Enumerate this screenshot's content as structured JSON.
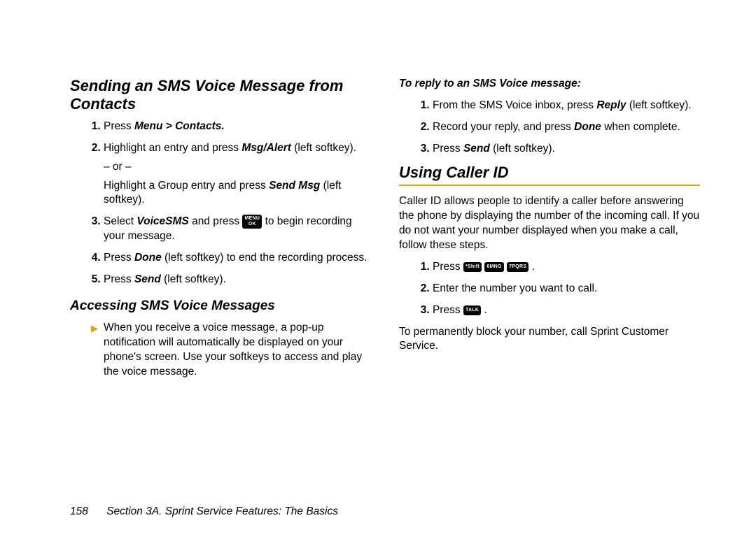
{
  "left": {
    "h1": "Sending an SMS Voice Message from Contacts",
    "steps": {
      "s1_a": "Press ",
      "s1_b": "Menu > Contacts.",
      "s2_a": "Highlight an entry and press ",
      "s2_b": "Msg/Alert",
      "s2_c": " (left softkey).",
      "s2_or": "– or –",
      "s2_d": "Highlight a Group entry and press ",
      "s2_e": "Send Msg",
      "s2_f": " (left softkey).",
      "s3_a": "Select ",
      "s3_b": "VoiceSMS",
      "s3_c": " and press ",
      "s3_key": "MENU\nOK",
      "s3_d": " to begin recording your message.",
      "s4_a": "Press ",
      "s4_b": "Done",
      "s4_c": " (left softkey) to end the recording process.",
      "s5_a": "Press ",
      "s5_b": "Send",
      "s5_c": " (left softkey)."
    },
    "h2": "Accessing SMS Voice Messages",
    "bullet": "When you receive a voice message, a pop-up notification will automatically be displayed on your phone's screen. Use your softkeys to access and play the voice message."
  },
  "right": {
    "h3": "To reply to an SMS Voice message:",
    "reply": {
      "r1_a": "From the SMS Voice inbox, press ",
      "r1_b": "Reply",
      "r1_c": " (left softkey).",
      "r2_a": "Record your reply, and press ",
      "r2_b": "Done",
      "r2_c": " when complete.",
      "r3_a": "Press ",
      "r3_b": "Send",
      "r3_c": " (left softkey)."
    },
    "h1": "Using Caller ID",
    "intro": "Caller ID allows people to identify a caller before answering the phone by displaying the number of the incoming call. If you do not want your number displayed when you make a call, follow these steps.",
    "cid": {
      "c1_a": "Press ",
      "c1_k1": "*Shift",
      "c1_k2": "6MNO",
      "c1_k3": "7PQRS",
      "c1_b": " .",
      "c2": "Enter the number you want to call.",
      "c3_a": "Press ",
      "c3_k": "TALK",
      "c3_b": " ."
    },
    "outro": "To permanently block your number, call Sprint Customer Service."
  },
  "footer": {
    "page": "158",
    "section": "Section 3A. Sprint Service Features: The Basics"
  }
}
